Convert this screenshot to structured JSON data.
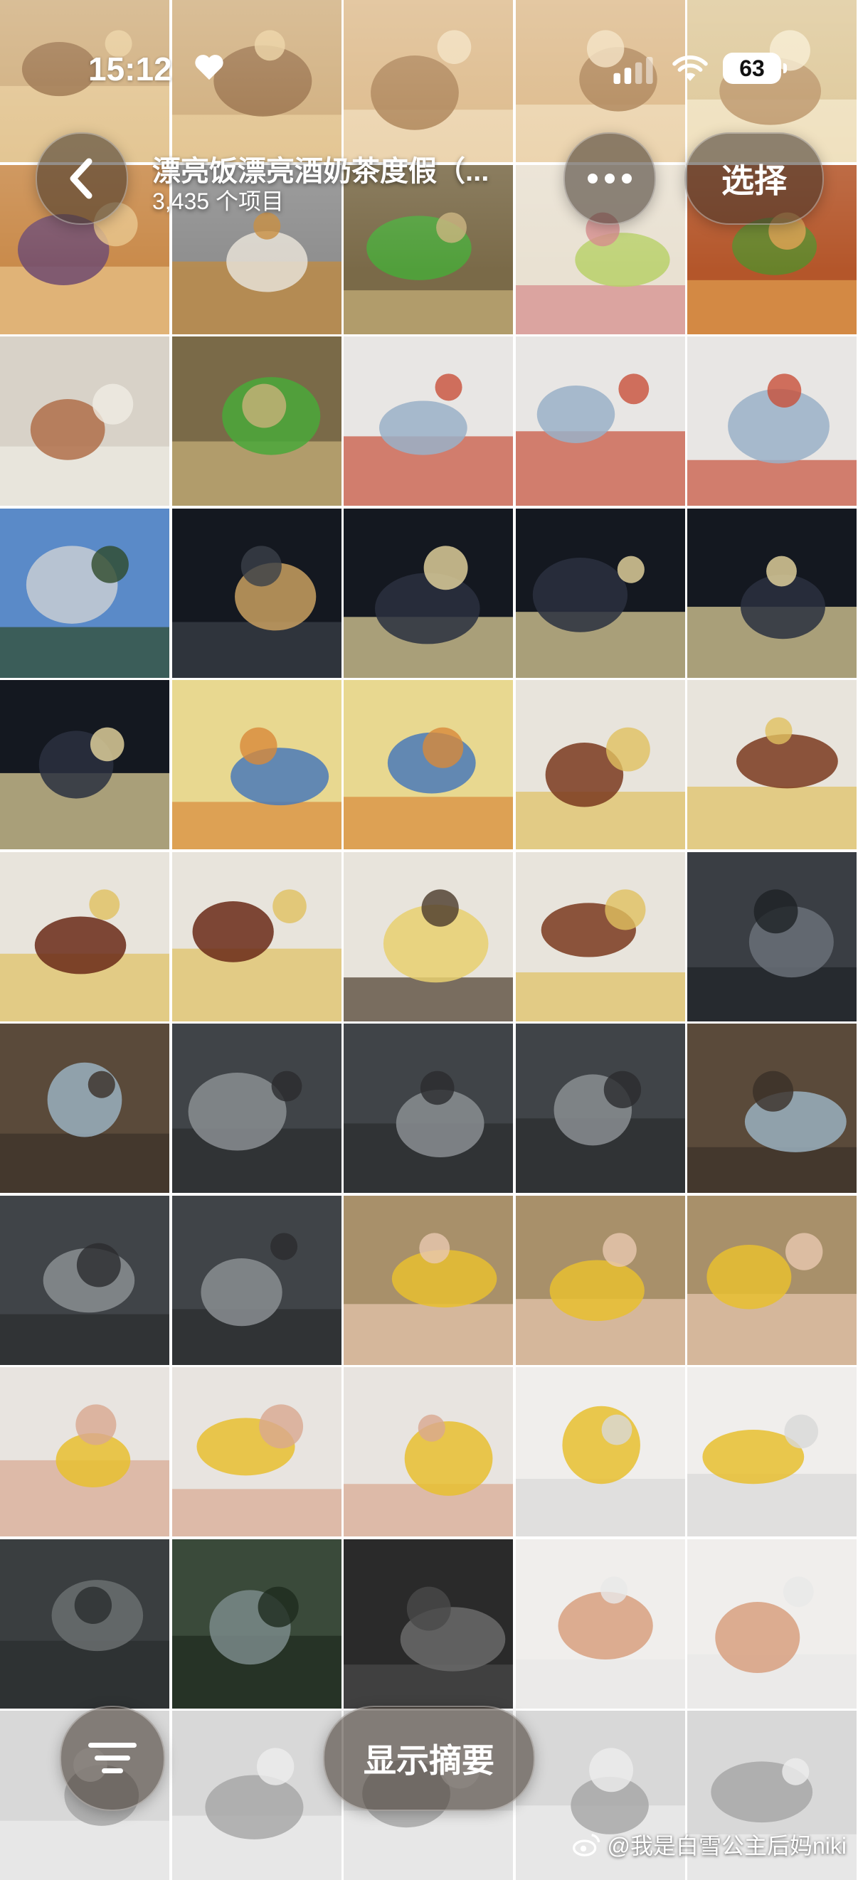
{
  "status_bar": {
    "time": "15:12",
    "battery": "63"
  },
  "header": {
    "album_title": "漂亮饭漂亮酒奶茶度假（...",
    "item_count": "3,435 个项目",
    "select_label": "选择"
  },
  "bottom": {
    "summary_label": "显示摘要"
  },
  "watermark": "@我是白雪公主后妈niki",
  "icons": [
    "heart-icon",
    "signal-icon",
    "wifi-icon",
    "chevron-left-icon",
    "more-icon",
    "sort-icon",
    "weibo-icon"
  ],
  "photos": [
    "bakery",
    "bakery",
    "donuts",
    "donuts",
    "pastries",
    "pastry-display",
    "tea-set",
    "fish-dish",
    "hotpot-ingredients",
    "salad-dish",
    "mall-interior",
    "fish-dish",
    "store-shelves",
    "store-shelves",
    "store-shelves",
    "buildings",
    "pagoda-night",
    "river-night",
    "river-night",
    "river-night",
    "river-night",
    "toy-story-card",
    "toy-story-card",
    "woody-watch",
    "woody-watch",
    "woody-holster",
    "woody-holster",
    "woody-card",
    "woody-watch",
    "window-night",
    "window",
    "blinds",
    "blinds",
    "blinds",
    "window",
    "blinds",
    "blinds",
    "fruit-cup",
    "fruit-cup",
    "fruit-cup",
    "fruit-cups",
    "fruit-cups",
    "fruit-cups",
    "fruit-bowl",
    "fruit-bowl",
    "courtyard",
    "trees",
    "building",
    "soup-bowl",
    "soup-bowl",
    "partial",
    "partial",
    "partial",
    "partial",
    "partial"
  ]
}
